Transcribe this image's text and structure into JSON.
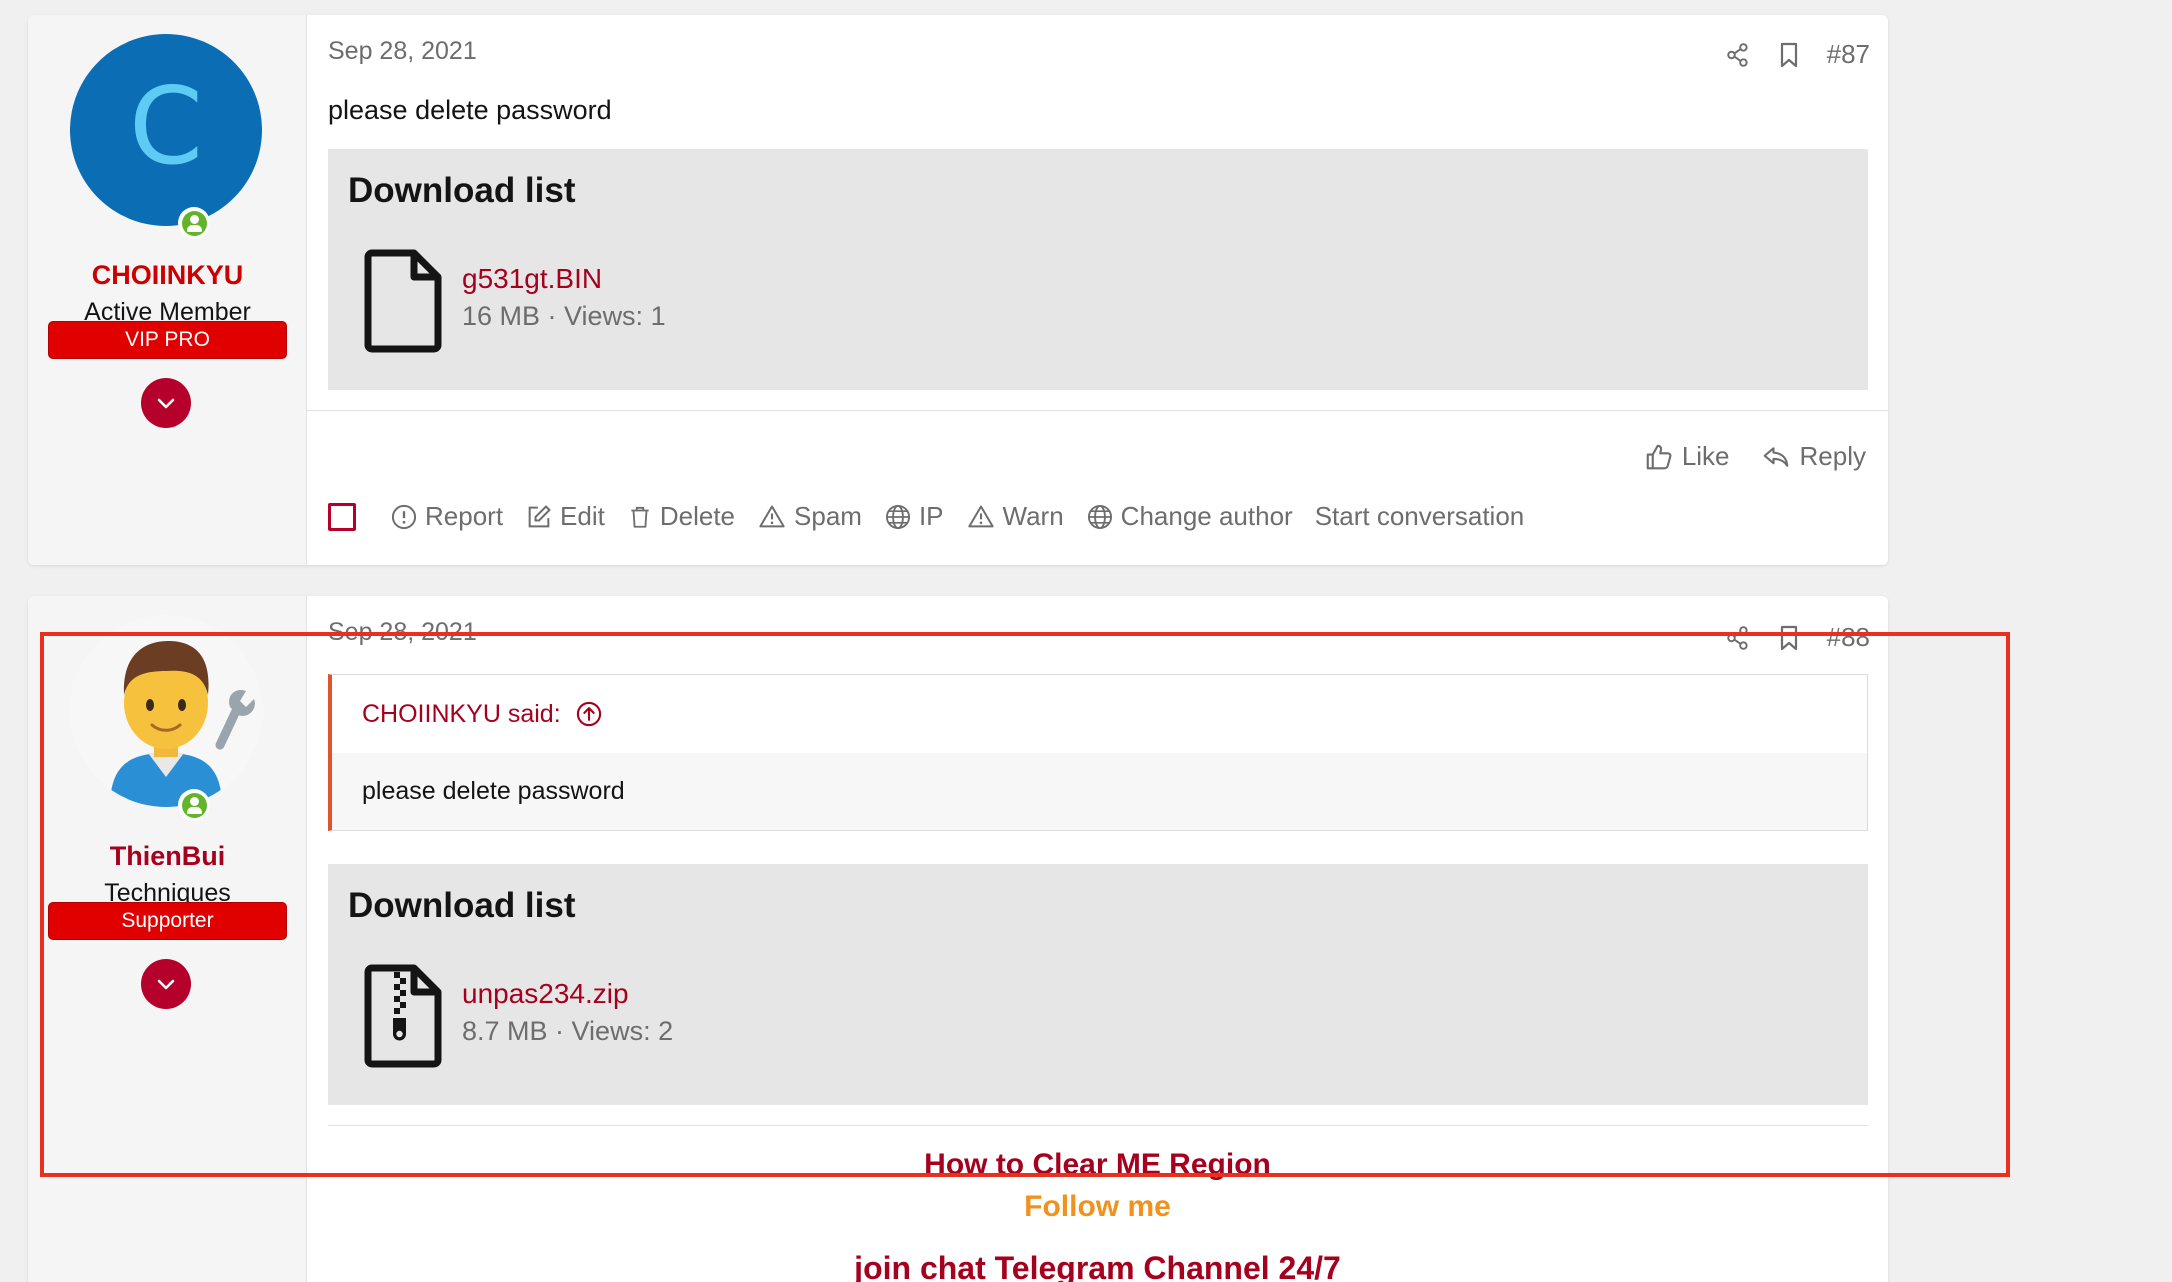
{
  "posts": [
    {
      "number": "#87",
      "date": "Sep 28, 2021",
      "user": {
        "avatar_letter": "C",
        "name": "CHOIINKYU",
        "title": "Active Member",
        "banner": "VIP PRO",
        "name_color": "#cc0000"
      },
      "message": "please delete password",
      "download": {
        "title": "Download list",
        "file_name": "g531gt.BIN",
        "file_meta": "16 MB · Views: 1",
        "icon": "file-icon"
      },
      "reactions": {
        "like": "Like",
        "reply": "Reply"
      },
      "mod_actions": [
        "Report",
        "Edit",
        "Delete",
        "Spam",
        "IP",
        "Warn",
        "Change author",
        "Start conversation"
      ]
    },
    {
      "number": "#88",
      "date": "Sep 28, 2021",
      "user": {
        "avatar_emoji": "👨‍🔧",
        "name": "ThienBui",
        "title": "Techniques",
        "banner": "Supporter",
        "name_color": "#a5001e"
      },
      "quote": {
        "author": "CHOIINKYU said:",
        "text": "please delete password"
      },
      "download": {
        "title": "Download list",
        "file_name": "unpas234.zip",
        "file_meta": "8.7 MB · Views: 2",
        "icon": "zip-file-icon"
      },
      "signature": {
        "line1": "How to Clear ME Region",
        "line2": "Follow me",
        "line3": "join chat Telegram Channel 24/7"
      }
    }
  ],
  "colors": {
    "accent": "#a5001e",
    "banner": "#e00000",
    "highlight": "#e8301c",
    "online": "#63b42b"
  }
}
